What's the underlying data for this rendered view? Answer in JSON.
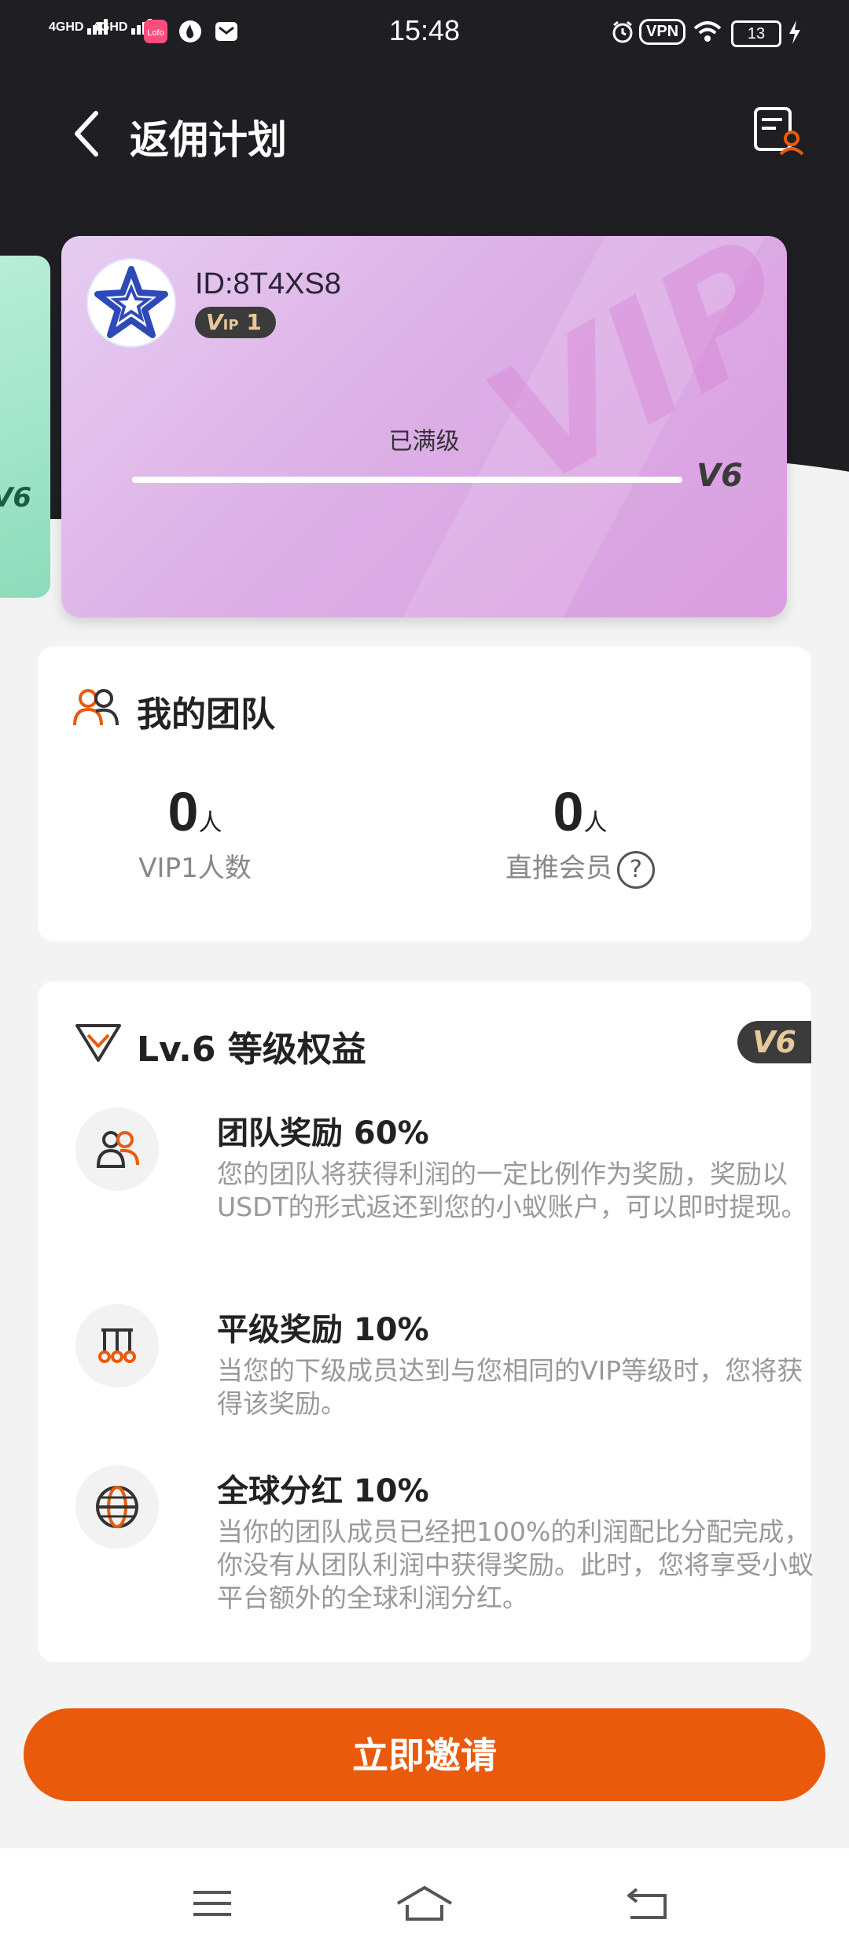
{
  "status_bar": {
    "time": "15:48",
    "network1": "4GHD",
    "network2": "4GHD",
    "vpn": "VPN",
    "battery": "13"
  },
  "header": {
    "title": "返佣计划"
  },
  "vip_card": {
    "user_id": "ID:8T4XS8",
    "vip_level_label": "1",
    "vip_prefix": "V",
    "vip_small": "IP",
    "status": "已满级",
    "progress": 1.0,
    "next_level": "V6",
    "side_level": "V6"
  },
  "team": {
    "title": "我的团队",
    "vip1_count": "0",
    "vip1_unit": "人",
    "vip1_label": "VIP1人数",
    "direct_count": "0",
    "direct_unit": "人",
    "direct_label": "直推会员",
    "help": "?"
  },
  "rights": {
    "title": "Lv.6 等级权益",
    "tag": "V6",
    "benefits": [
      {
        "title": "团队奖励 60%",
        "desc": "您的团队将获得利润的一定比例作为奖励，奖励以USDT的形式返还到您的小蚁账户，可以即时提现。"
      },
      {
        "title": "平级奖励 10%",
        "desc": "当您的下级成员达到与您相同的VIP等级时，您将获得该奖励。"
      },
      {
        "title": "全球分红 10%",
        "desc": "当你的团队成员已经把100%的利润配比分配完成，你没有从团队利润中获得奖励。此时，您将享受小蚁平台额外的全球利润分红。"
      }
    ]
  },
  "invite_button": "立即邀请",
  "colors": {
    "accent": "#ea5a0c",
    "header_bg": "#1f1f23",
    "card_gradient_start": "#e6ccf0",
    "card_gradient_end": "#d99edf"
  }
}
